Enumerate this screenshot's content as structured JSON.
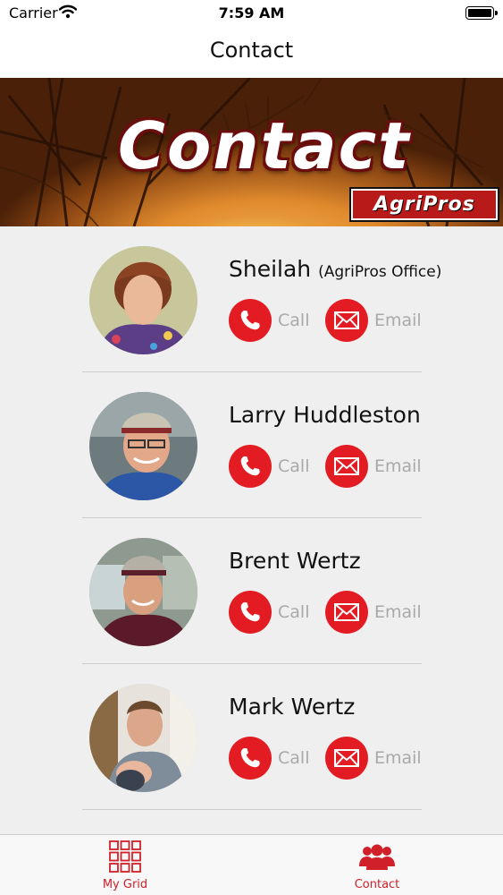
{
  "status_bar": {
    "carrier": "Carrier",
    "time": "7:59 AM"
  },
  "nav": {
    "title": "Contact"
  },
  "banner": {
    "title": "Contact",
    "logo": "AgriPros"
  },
  "contacts": [
    {
      "name": "Sheilah",
      "subtitle": "(AgriPros Office)",
      "call_label": "Call",
      "email_label": "Email"
    },
    {
      "name": "Larry Huddleston",
      "subtitle": "",
      "call_label": "Call",
      "email_label": "Email"
    },
    {
      "name": "Brent Wertz",
      "subtitle": "",
      "call_label": "Call",
      "email_label": "Email"
    },
    {
      "name": "Mark Wertz",
      "subtitle": "",
      "call_label": "Call",
      "email_label": "Email"
    }
  ],
  "tab_bar": {
    "items": [
      {
        "label": "My Grid",
        "icon": "grid-icon"
      },
      {
        "label": "Contact",
        "icon": "people-icon"
      }
    ]
  },
  "colors": {
    "accent": "#e31b23",
    "muted_text": "#a9a9a9",
    "background": "#efefef"
  }
}
